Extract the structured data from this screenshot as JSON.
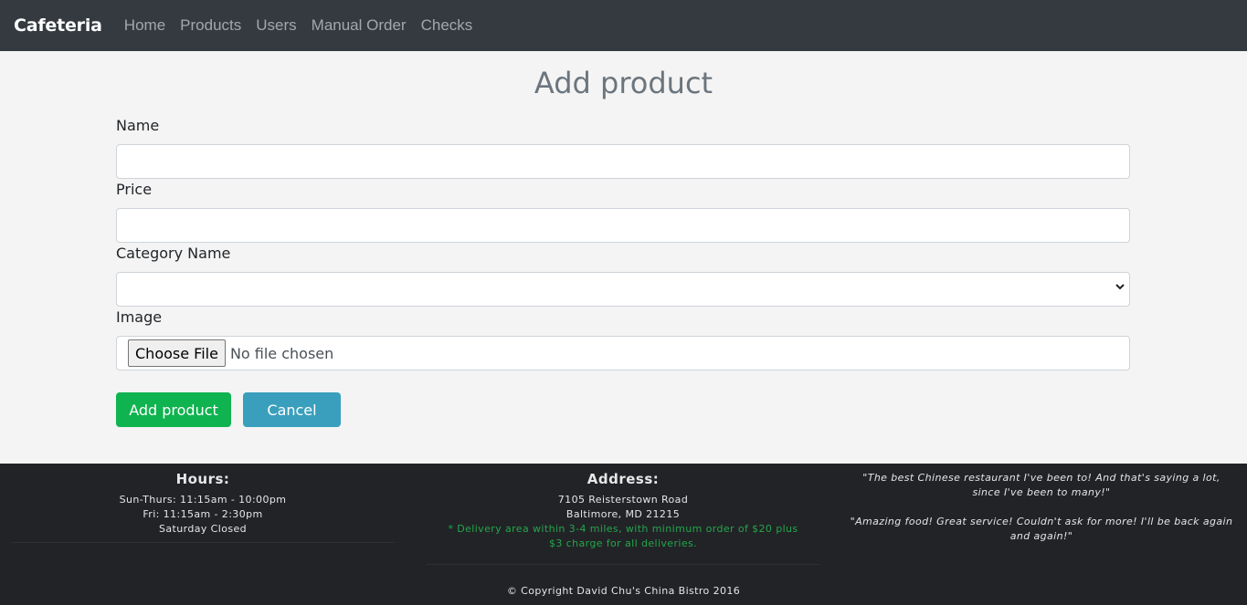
{
  "navbar": {
    "brand": "Cafeteria",
    "links": [
      "Home",
      "Products",
      "Users",
      "Manual Order",
      "Checks"
    ]
  },
  "page": {
    "title": "Add product"
  },
  "form": {
    "name_label": "Name",
    "name_value": "",
    "price_label": "Price",
    "price_value": "",
    "category_label": "Category Name",
    "category_selected": "",
    "image_label": "Image",
    "file_button_label": "Choose File",
    "file_status": "No file chosen",
    "submit_label": "Add product",
    "cancel_label": "Cancel"
  },
  "footer": {
    "hours": {
      "heading": "Hours:",
      "lines": [
        "Sun-Thurs: 11:15am - 10:00pm",
        "Fri: 11:15am - 2:30pm",
        "Saturday Closed"
      ]
    },
    "address": {
      "heading": "Address:",
      "lines": [
        "7105 Reisterstown Road",
        "Baltimore, MD 21215"
      ],
      "note": "* Delivery area within 3-4 miles, with minimum order of $20 plus $3 charge for all deliveries."
    },
    "reviews": [
      "\"The best Chinese restaurant I've been to! And that's saying a lot, since I've been to many!\"",
      "\"Amazing food! Great service! Couldn't ask for more! I'll be back again and again!\""
    ],
    "copyright": "© Copyright David Chu's China Bistro 2016"
  },
  "colors": {
    "navbar_bg": "#343a40",
    "success": "#0fb34f",
    "info": "#3a9fbd",
    "footer_bg": "#222327",
    "footer_note": "#23a64a"
  }
}
